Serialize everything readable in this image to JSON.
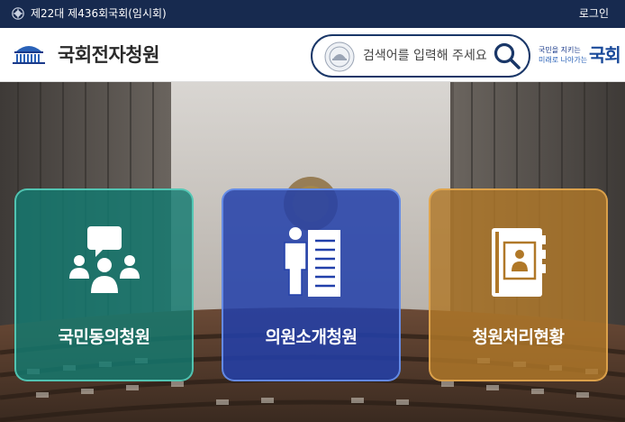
{
  "topbar": {
    "session_text": "제22대 제436회국회(임시회)",
    "login_label": "로그인"
  },
  "header": {
    "site_title": "국회전자청원",
    "search": {
      "placeholder": "검색어를 입력해 주세요"
    },
    "slogan": {
      "line1": "국민을 지키는",
      "line2": "미래로 나아가는",
      "big": "국회"
    }
  },
  "cards": [
    {
      "label": "국민동의청원",
      "icon": "people-discussion-icon",
      "color": "#127a70"
    },
    {
      "label": "의원소개청원",
      "icon": "person-document-icon",
      "color": "#2240aa"
    },
    {
      "label": "청원처리현황",
      "icon": "profile-book-icon",
      "color": "#b07828"
    }
  ],
  "colors": {
    "topbar": "#172a4f",
    "brand_navy": "#1a3768"
  }
}
